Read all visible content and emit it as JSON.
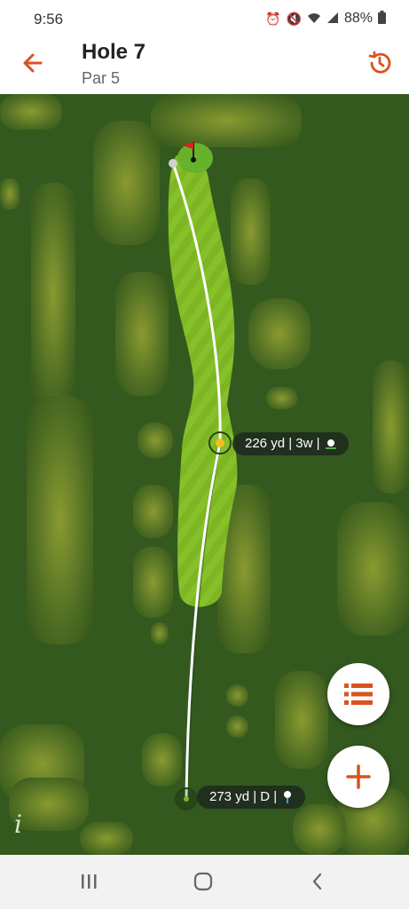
{
  "status": {
    "time": "9:56",
    "battery": "88%"
  },
  "header": {
    "title": "Hole 7",
    "subtitle": "Par 5"
  },
  "map": {
    "target_label": "226 yd | 3w |",
    "tee_label": "273 yd | D |"
  },
  "icons": {
    "back": "arrow-left-icon",
    "history": "history-icon",
    "list": "list-icon",
    "add": "plus-icon",
    "info": "info-icon"
  },
  "colors": {
    "accent": "#d9531e",
    "fairway": "#7db622",
    "rough": "#33591f",
    "trees": "#5b7a28"
  }
}
